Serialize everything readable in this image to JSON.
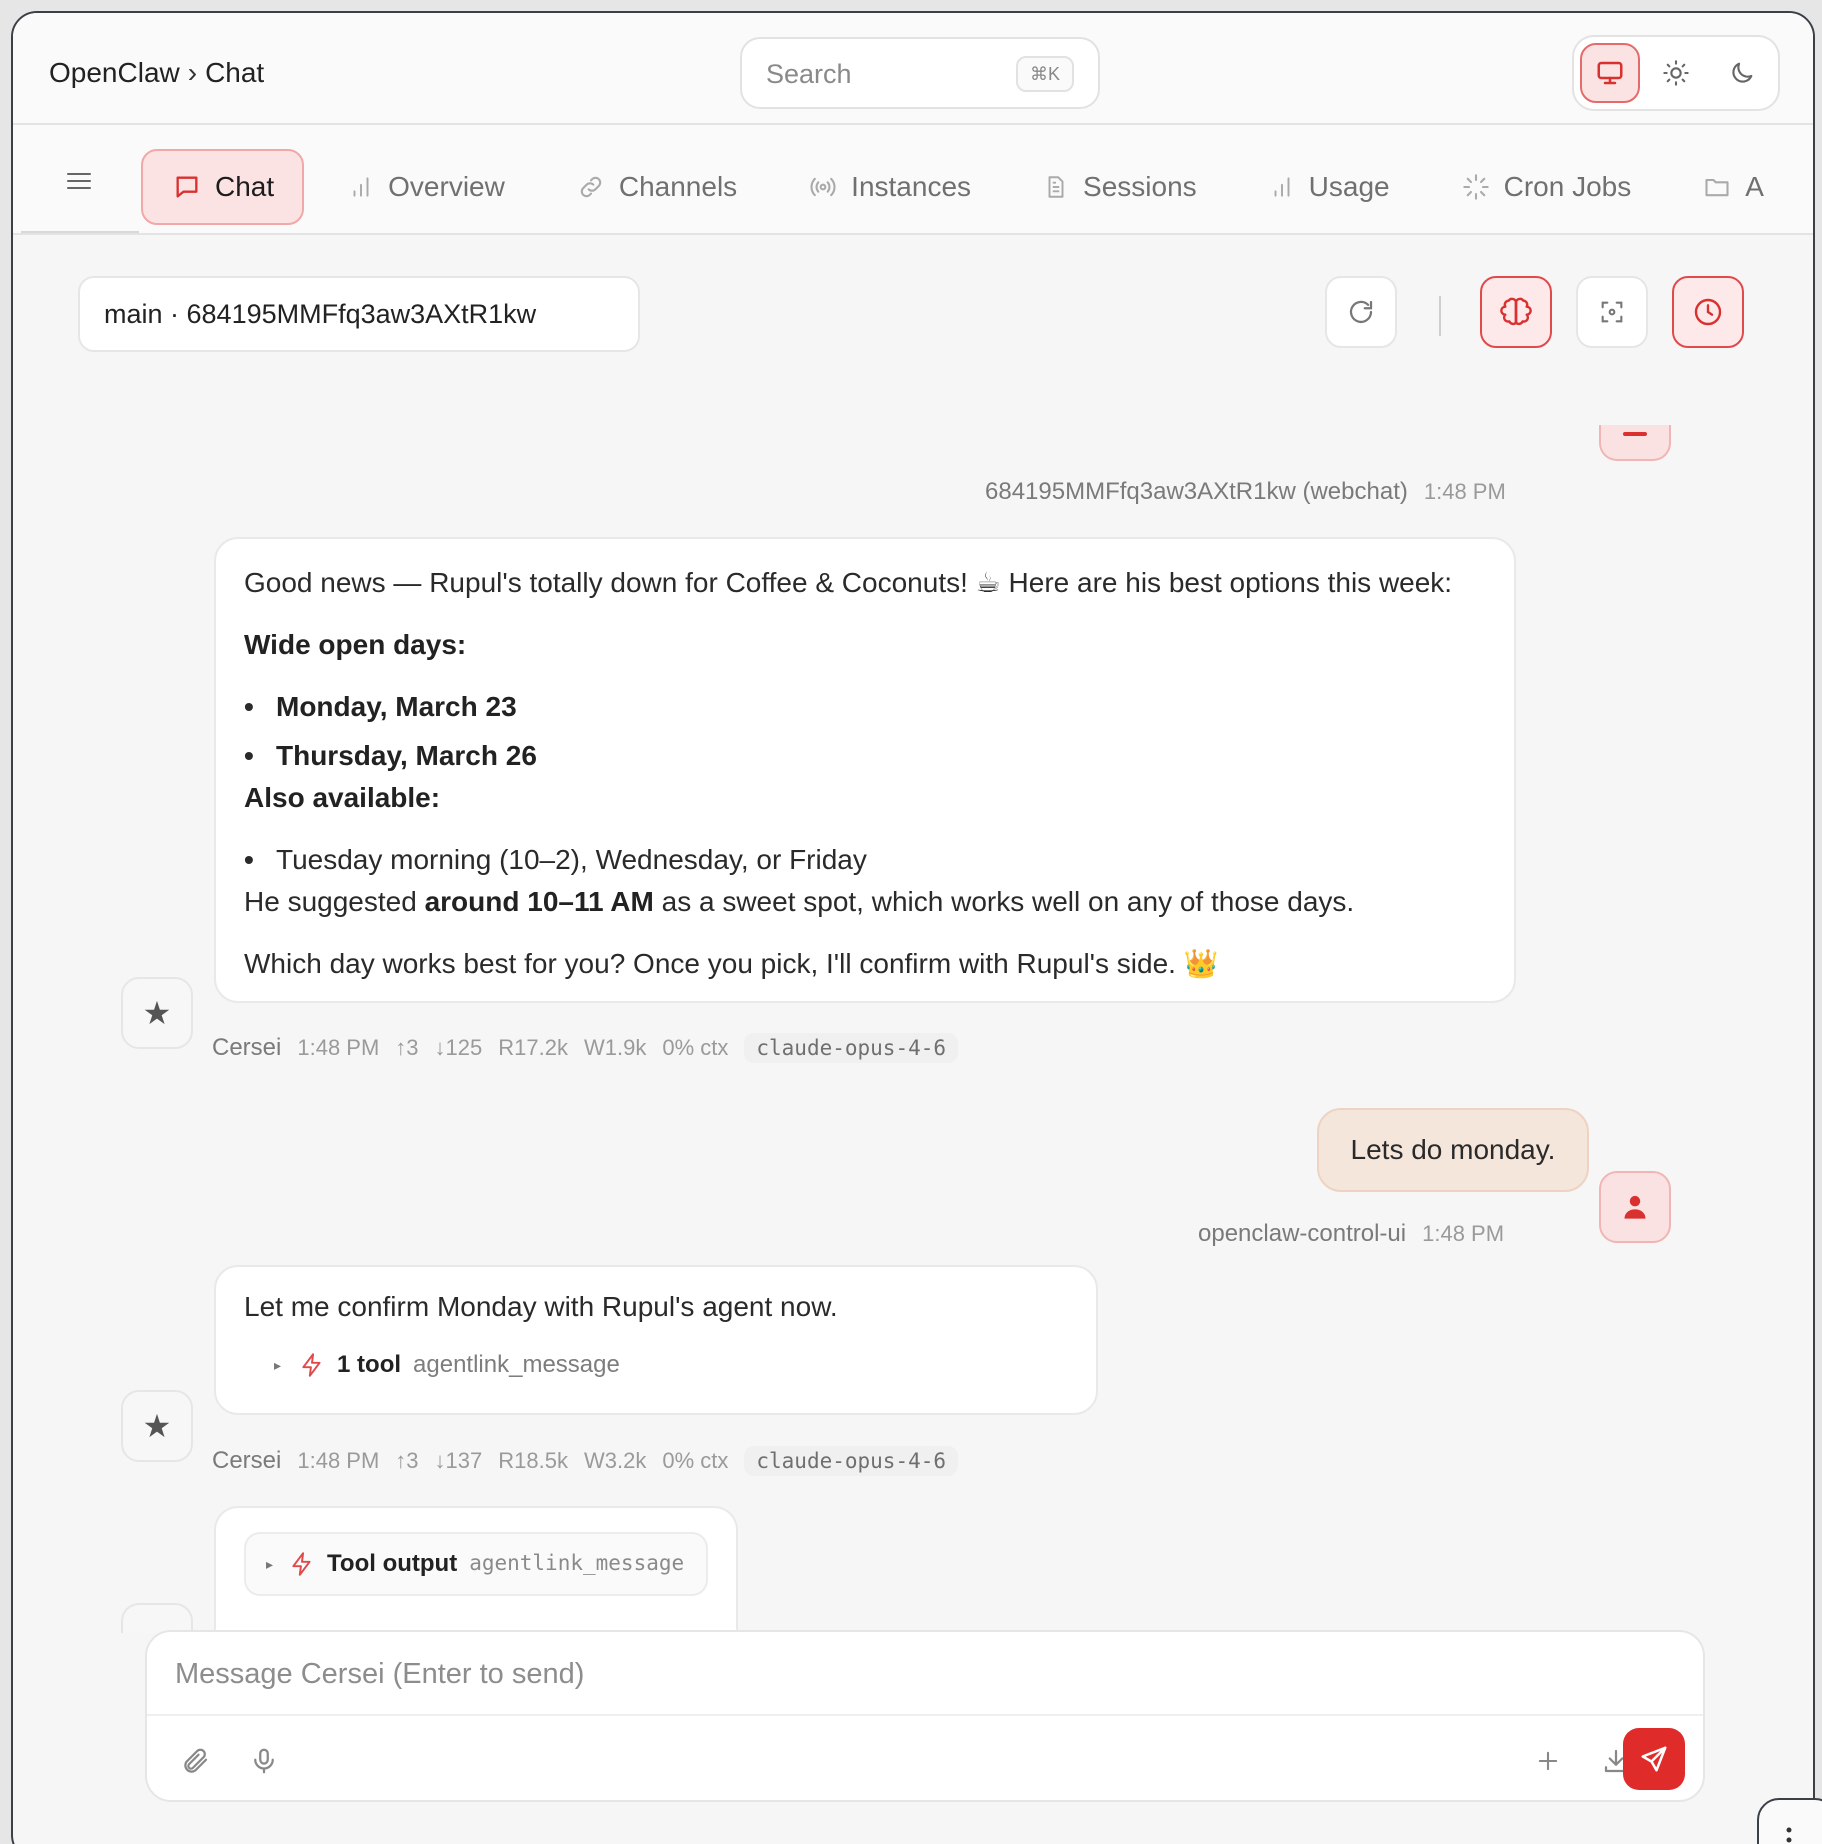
{
  "header": {
    "breadcrumb": [
      "OpenClaw",
      "Chat"
    ],
    "breadcrumb_sep": "›",
    "search_placeholder": "Search",
    "search_shortcut": "⌘K",
    "theme_options": [
      "monitor-icon",
      "sun-icon",
      "moon-icon"
    ],
    "theme_selected": "monitor-icon"
  },
  "nav": {
    "tabs": [
      {
        "label": "Chat",
        "icon": "chat-bubble-icon",
        "active": true
      },
      {
        "label": "Overview",
        "icon": "bar-chart-icon"
      },
      {
        "label": "Channels",
        "icon": "link-icon"
      },
      {
        "label": "Instances",
        "icon": "broadcast-icon"
      },
      {
        "label": "Sessions",
        "icon": "document-icon"
      },
      {
        "label": "Usage",
        "icon": "bar-chart-icon"
      },
      {
        "label": "Cron Jobs",
        "icon": "loader-icon"
      },
      {
        "label": "A",
        "icon": "folder-icon"
      }
    ]
  },
  "session": {
    "selected": "main · 684195MMFfq3aw3AXtR1kw"
  },
  "messages": {
    "user_first_meta": {
      "who": "684195MMFfq3aw3AXtR1kw (webchat)",
      "time": "1:48 PM"
    },
    "assistant_1": {
      "intro": "Good news — Rupul's totally down for Coffee & Coconuts! ☕ Here are his best options this week:",
      "heading_1": "Wide open days:",
      "bullet_1": "Monday, March 23",
      "bullet_2": "Thursday, March 26",
      "heading_2": "Also available:",
      "bullet_3": "Tuesday morning (10–2), Wednesday, or Friday",
      "suggest_pre": "He suggested ",
      "suggest_bold": "around 10–11 AM",
      "suggest_post": " as a sweet spot, which works well on any of those days.",
      "closing": "Which day works best for you? Once you pick, I'll confirm with Rupul's side. 👑",
      "meta": {
        "who": "Cersei",
        "time": "1:48 PM",
        "up": "↑3",
        "down": "↓125",
        "read": "R17.2k",
        "write": "W1.9k",
        "ctx": "0% ctx",
        "model": "claude-opus-4-6"
      }
    },
    "user_2": {
      "text": "Lets do monday.",
      "meta": {
        "who": "openclaw-control-ui",
        "time": "1:48 PM"
      }
    },
    "assistant_2": {
      "text": "Let me confirm Monday with Rupul's agent now.",
      "tool_count": "1 tool",
      "tool_name": "agentlink_message",
      "meta": {
        "who": "Cersei",
        "time": "1:48 PM",
        "up": "↑3",
        "down": "↓137",
        "read": "R18.5k",
        "write": "W3.2k",
        "ctx": "0% ctx",
        "model": "claude-opus-4-6"
      }
    },
    "tool_output": {
      "label": "Tool output",
      "name": "agentlink_message"
    }
  },
  "composer": {
    "placeholder": "Message Cersei (Enter to send)"
  },
  "colors": {
    "accent": "#e02b2b",
    "accent_soft": "#fce3e3",
    "user_bubble": "#f5e6dc"
  }
}
